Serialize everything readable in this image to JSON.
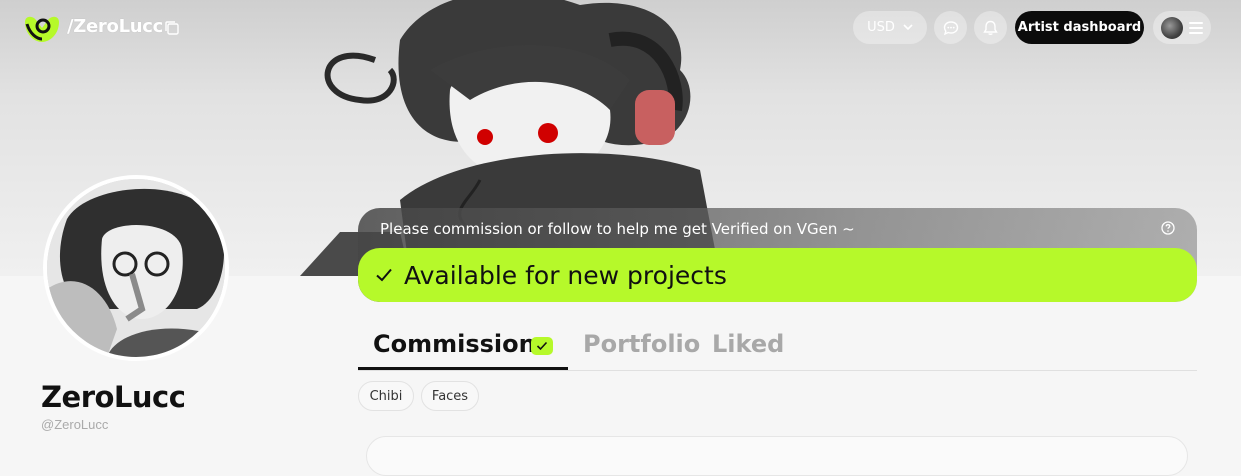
{
  "header": {
    "title": "/ZeroLucc",
    "currency": "USD",
    "artist_dashboard_label": "Artist dashboard"
  },
  "notice": {
    "message": "Please commission or follow to help me get Verified on VGen ~",
    "status": "Available for new projects"
  },
  "tabs": [
    {
      "label": "Commissions",
      "active": true
    },
    {
      "label": "Portfolio",
      "active": false
    },
    {
      "label": "Liked",
      "active": false
    }
  ],
  "filters": [
    "Chibi",
    "Faces"
  ],
  "profile": {
    "name": "ZeroLucc",
    "handle": "@ZeroLucc"
  },
  "colors": {
    "accent": "#b6f92a",
    "dark_button": "#0b0b0b",
    "muted_tab": "#a8a8a8"
  },
  "icons": [
    "logo-icon",
    "copy-icon",
    "chevron-down-icon",
    "chat-icon",
    "bell-icon",
    "hamburger-icon",
    "help-icon",
    "check-icon"
  ]
}
